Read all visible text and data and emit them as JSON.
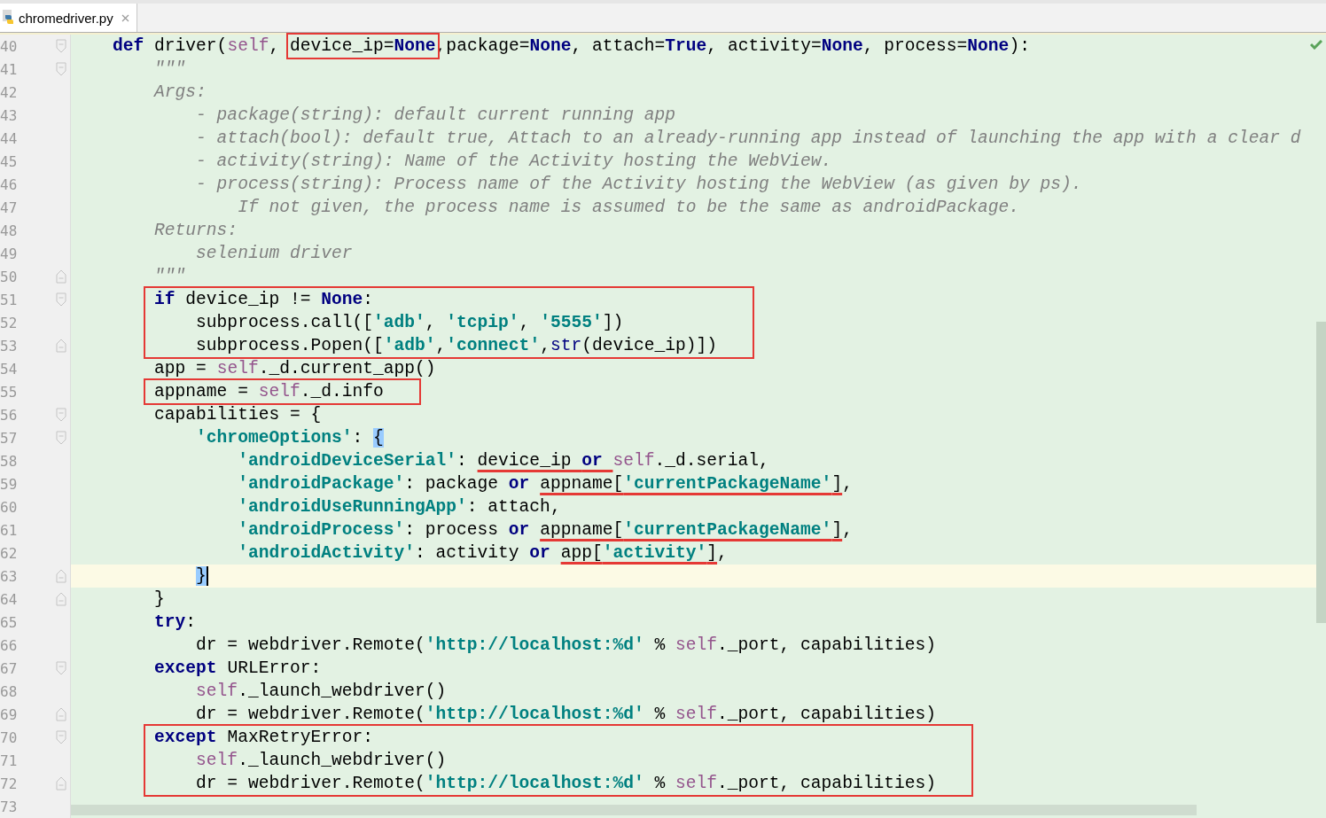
{
  "tabs": [
    {
      "label": "chromedriver.py",
      "selected": true,
      "closable": true
    }
  ],
  "lines": [
    {
      "number": "40",
      "fold_start": true,
      "tokens": [
        {
          "kind": "keyword",
          "text": "def"
        },
        {
          "kind": "plain",
          "text": " driver("
        },
        {
          "kind": "self",
          "text": "self"
        },
        {
          "kind": "plain",
          "text": ", "
        },
        {
          "kind": "boxed",
          "tokens": [
            {
              "kind": "plain",
              "text": "device_ip="
            },
            {
              "kind": "keyword",
              "text": "None"
            }
          ]
        },
        {
          "kind": "plain",
          "text": ",package="
        },
        {
          "kind": "keyword",
          "text": "None"
        },
        {
          "kind": "plain",
          "text": ", attach="
        },
        {
          "kind": "keyword",
          "text": "True"
        },
        {
          "kind": "plain",
          "text": ", activity="
        },
        {
          "kind": "keyword",
          "text": "None"
        },
        {
          "kind": "plain",
          "text": ", process="
        },
        {
          "kind": "keyword",
          "text": "None"
        },
        {
          "kind": "plain",
          "text": "):"
        }
      ],
      "children": [
        {
          "number": "41",
          "fold_start": true,
          "tokens": [
            {
              "kind": "doc",
              "text": "\"\"\""
            }
          ]
        },
        {
          "number": "42",
          "tokens": [
            {
              "kind": "doc",
              "text": "Args:"
            }
          ],
          "children": [
            {
              "number": "43",
              "tokens": [
                {
                  "kind": "doc",
                  "text": "- package(string): default current running app"
                }
              ]
            },
            {
              "number": "44",
              "tokens": [
                {
                  "kind": "doc",
                  "text": "- attach(bool): default true, Attach to an already-running app instead of launching the app with a clear d"
                }
              ]
            },
            {
              "number": "45",
              "tokens": [
                {
                  "kind": "doc",
                  "text": "- activity(string): Name of the Activity hosting the WebView."
                }
              ]
            },
            {
              "number": "46",
              "tokens": [
                {
                  "kind": "doc",
                  "text": "- process(string): Process name of the Activity hosting the WebView (as given by ps)."
                }
              ],
              "children": [
                {
                  "number": "47",
                  "tokens": [
                    {
                      "kind": "doc",
                      "text": "If not given, the process name is assumed to be the same as androidPackage."
                    }
                  ]
                }
              ]
            }
          ]
        },
        {
          "number": "48",
          "tokens": [
            {
              "kind": "doc",
              "text": "Returns:"
            }
          ],
          "children": [
            {
              "number": "49",
              "tokens": [
                {
                  "kind": "doc",
                  "text": "selenium driver"
                }
              ]
            }
          ]
        },
        {
          "number": "50",
          "fold_end": true,
          "tokens": [
            {
              "kind": "doc",
              "text": "\"\"\""
            }
          ]
        },
        {
          "boxed": true,
          "children": [
            {
              "number": "51",
              "fold_start": true,
              "tokens": [
                {
                  "kind": "keyword",
                  "text": "if"
                },
                {
                  "kind": "plain",
                  "text": " device_ip != "
                },
                {
                  "kind": "keyword",
                  "text": "None"
                },
                {
                  "kind": "plain",
                  "text": ":"
                }
              ],
              "children": [
                {
                  "number": "52",
                  "tokens": [
                    {
                      "kind": "plain",
                      "text": "subprocess.call(["
                    },
                    {
                      "kind": "string",
                      "text": "'adb'"
                    },
                    {
                      "kind": "plain",
                      "text": ", "
                    },
                    {
                      "kind": "string",
                      "text": "'tcpip'"
                    },
                    {
                      "kind": "plain",
                      "text": ", "
                    },
                    {
                      "kind": "string",
                      "text": "'5555'"
                    },
                    {
                      "kind": "plain",
                      "text": "])"
                    }
                  ]
                },
                {
                  "number": "53",
                  "fold_end": true,
                  "tokens": [
                    {
                      "kind": "plain",
                      "text": "subprocess.Popen(["
                    },
                    {
                      "kind": "string",
                      "text": "'adb'"
                    },
                    {
                      "kind": "plain",
                      "text": ","
                    },
                    {
                      "kind": "string",
                      "text": "'connect'"
                    },
                    {
                      "kind": "plain",
                      "text": ","
                    },
                    {
                      "kind": "builtin",
                      "text": "str"
                    },
                    {
                      "kind": "plain",
                      "text": "(device_ip)])"
                    }
                  ]
                }
              ]
            }
          ]
        },
        {
          "number": "54",
          "tokens": [
            {
              "kind": "plain",
              "text": "app = "
            },
            {
              "kind": "self",
              "text": "self"
            },
            {
              "kind": "plain",
              "text": "._d.current_app()"
            }
          ]
        },
        {
          "boxed": true,
          "children": [
            {
              "number": "55",
              "tokens": [
                {
                  "kind": "plain",
                  "text": "appname = "
                },
                {
                  "kind": "self",
                  "text": "self"
                },
                {
                  "kind": "plain",
                  "text": "._d.info"
                }
              ]
            }
          ]
        },
        {
          "number": "56",
          "fold_start": true,
          "tokens": [
            {
              "kind": "plain",
              "text": "capabilities = {"
            }
          ],
          "children": [
            {
              "number": "57",
              "fold_start": true,
              "tokens": [
                {
                  "kind": "string",
                  "text": "'chromeOptions'"
                },
                {
                  "kind": "plain",
                  "text": ": "
                },
                {
                  "kind": "match",
                  "text": "{"
                }
              ],
              "children": [
                {
                  "number": "58",
                  "tokens": [
                    {
                      "kind": "string",
                      "text": "'androidDeviceSerial'"
                    },
                    {
                      "kind": "plain",
                      "text": ": "
                    },
                    {
                      "kind": "underlined",
                      "tokens": [
                        {
                          "kind": "plain",
                          "text": "device_ip "
                        },
                        {
                          "kind": "keyword",
                          "text": "or "
                        }
                      ]
                    },
                    {
                      "kind": "self",
                      "text": "self"
                    },
                    {
                      "kind": "plain",
                      "text": "._d.serial,"
                    }
                  ]
                },
                {
                  "number": "59",
                  "tokens": [
                    {
                      "kind": "string",
                      "text": "'androidPackage'"
                    },
                    {
                      "kind": "plain",
                      "text": ": package "
                    },
                    {
                      "kind": "keyword",
                      "text": "or "
                    },
                    {
                      "kind": "underlined",
                      "tokens": [
                        {
                          "kind": "plain",
                          "text": "appname["
                        },
                        {
                          "kind": "string",
                          "text": "'currentPackageName'"
                        },
                        {
                          "kind": "plain",
                          "text": "]"
                        }
                      ]
                    },
                    {
                      "kind": "plain",
                      "text": ","
                    }
                  ]
                },
                {
                  "number": "60",
                  "tokens": [
                    {
                      "kind": "string",
                      "text": "'androidUseRunningApp'"
                    },
                    {
                      "kind": "plain",
                      "text": ": attach,"
                    }
                  ]
                },
                {
                  "number": "61",
                  "tokens": [
                    {
                      "kind": "string",
                      "text": "'androidProcess'"
                    },
                    {
                      "kind": "plain",
                      "text": ": process "
                    },
                    {
                      "kind": "keyword",
                      "text": "or "
                    },
                    {
                      "kind": "underlined",
                      "tokens": [
                        {
                          "kind": "plain",
                          "text": "appname["
                        },
                        {
                          "kind": "string",
                          "text": "'currentPackageName'"
                        },
                        {
                          "kind": "plain",
                          "text": "]"
                        }
                      ]
                    },
                    {
                      "kind": "plain",
                      "text": ","
                    }
                  ]
                },
                {
                  "number": "62",
                  "tokens": [
                    {
                      "kind": "string",
                      "text": "'androidActivity'"
                    },
                    {
                      "kind": "plain",
                      "text": ": activity "
                    },
                    {
                      "kind": "keyword",
                      "text": "or "
                    },
                    {
                      "kind": "underlined",
                      "tokens": [
                        {
                          "kind": "plain",
                          "text": "app["
                        },
                        {
                          "kind": "string",
                          "text": "'activity'"
                        },
                        {
                          "kind": "plain",
                          "text": "]"
                        }
                      ]
                    },
                    {
                      "kind": "plain",
                      "text": ","
                    }
                  ]
                }
              ]
            },
            {
              "number": "63",
              "fold_end": true,
              "current": true,
              "caret": true,
              "tokens": [
                {
                  "kind": "match",
                  "text": "}"
                }
              ]
            }
          ]
        },
        {
          "number": "64",
          "fold_end": true,
          "tokens": [
            {
              "kind": "plain",
              "text": "}"
            }
          ]
        },
        {
          "number": "65",
          "tokens": [
            {
              "kind": "keyword",
              "text": "try"
            },
            {
              "kind": "plain",
              "text": ":"
            }
          ],
          "children": [
            {
              "number": "66",
              "tokens": [
                {
                  "kind": "plain",
                  "text": "dr = webdriver.Remote("
                },
                {
                  "kind": "string",
                  "text": "'http://localhost:%d'"
                },
                {
                  "kind": "plain",
                  "text": " % "
                },
                {
                  "kind": "self",
                  "text": "self"
                },
                {
                  "kind": "plain",
                  "text": "._port, capabilities)"
                }
              ]
            }
          ]
        },
        {
          "number": "67",
          "fold_start": true,
          "tokens": [
            {
              "kind": "keyword",
              "text": "except"
            },
            {
              "kind": "plain",
              "text": " URLError:"
            }
          ],
          "children": [
            {
              "number": "68",
              "tokens": [
                {
                  "kind": "self",
                  "text": "self"
                },
                {
                  "kind": "plain",
                  "text": "._launch_webdriver()"
                }
              ]
            },
            {
              "number": "69",
              "fold_end": true,
              "tokens": [
                {
                  "kind": "plain",
                  "text": "dr = webdriver.Remote("
                },
                {
                  "kind": "string",
                  "text": "'http://localhost:%d'"
                },
                {
                  "kind": "plain",
                  "text": " % "
                },
                {
                  "kind": "self",
                  "text": "self"
                },
                {
                  "kind": "plain",
                  "text": "._port, capabilities)"
                }
              ]
            }
          ]
        },
        {
          "boxed": true,
          "children": [
            {
              "number": "70",
              "fold_start": true,
              "tokens": [
                {
                  "kind": "keyword",
                  "text": "except"
                },
                {
                  "kind": "plain",
                  "text": " MaxRetryError:"
                }
              ],
              "children": [
                {
                  "number": "71",
                  "tokens": [
                    {
                      "kind": "self",
                      "text": "self"
                    },
                    {
                      "kind": "plain",
                      "text": "._launch_webdriver()"
                    }
                  ]
                },
                {
                  "number": "72",
                  "fold_end": true,
                  "tokens": [
                    {
                      "kind": "plain",
                      "text": "dr = webdriver.Remote("
                    },
                    {
                      "kind": "string",
                      "text": "'http://localhost:%d'"
                    },
                    {
                      "kind": "plain",
                      "text": " % "
                    },
                    {
                      "kind": "self",
                      "text": "self"
                    },
                    {
                      "kind": "plain",
                      "text": "._port, capabilities)"
                    }
                  ]
                }
              ]
            }
          ]
        }
      ]
    },
    {
      "number": "73"
    }
  ]
}
